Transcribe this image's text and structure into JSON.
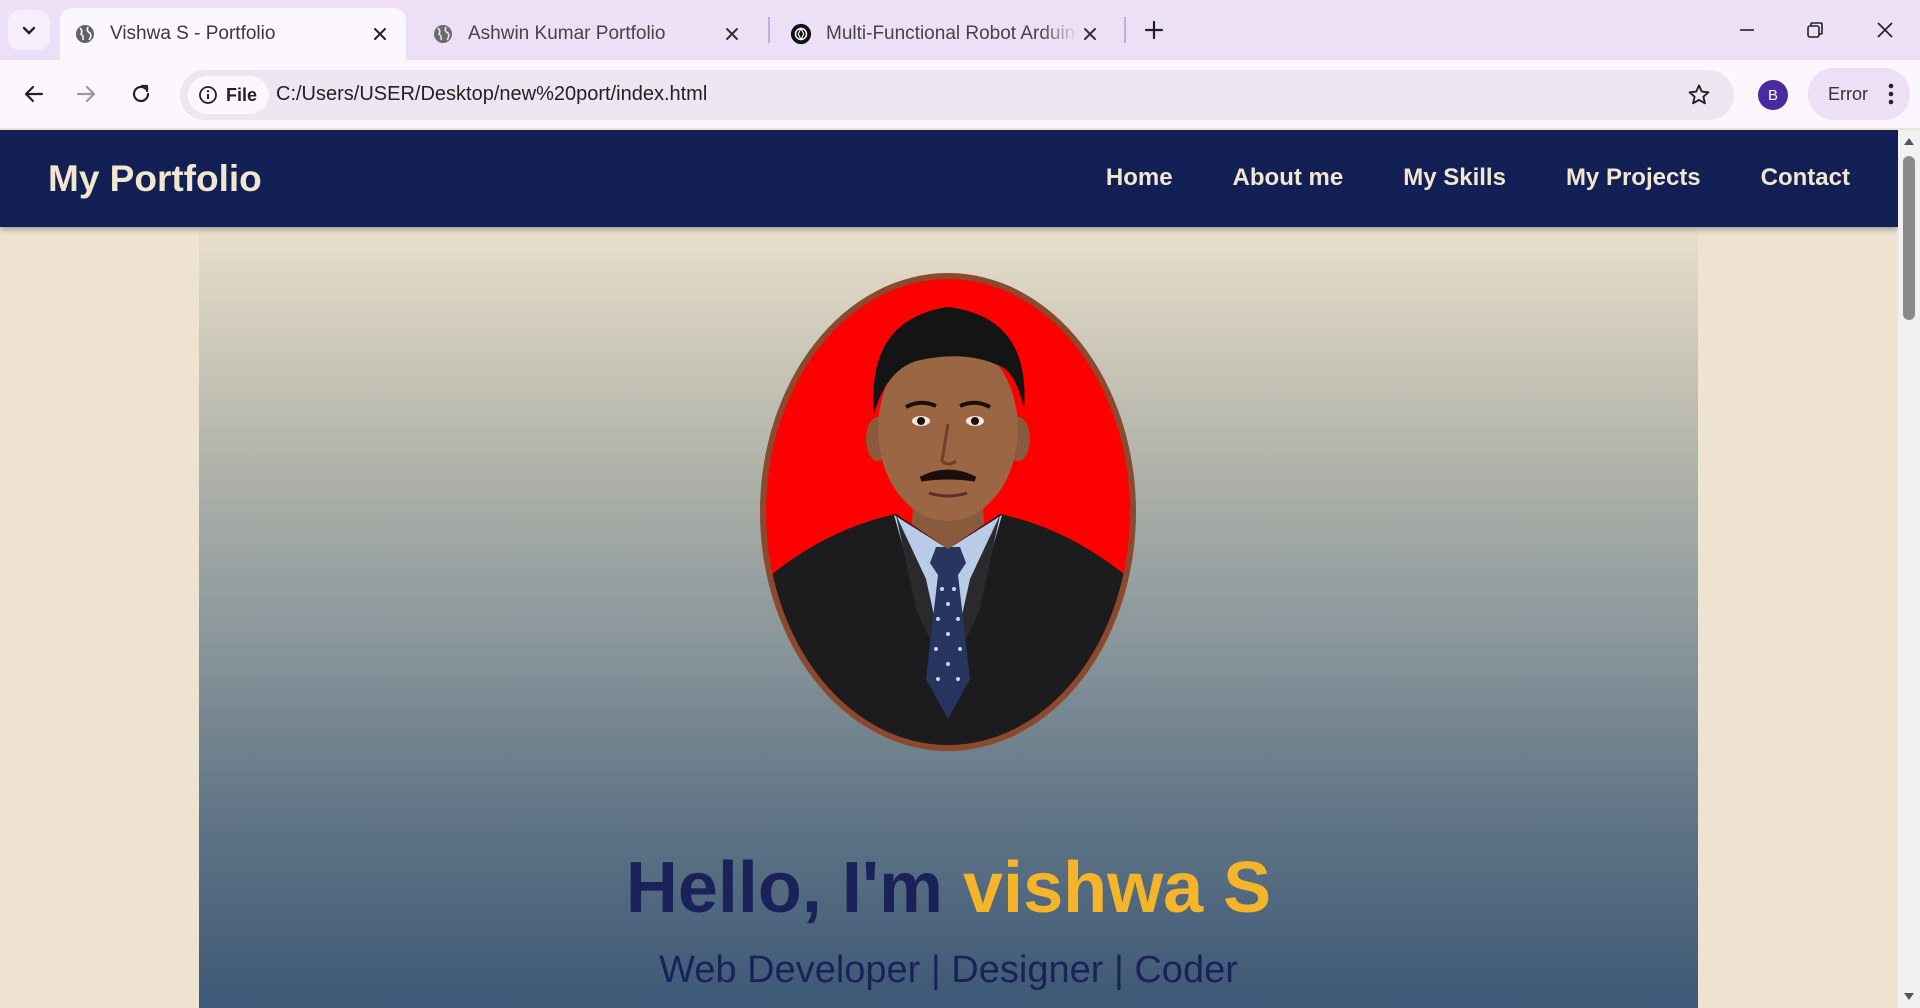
{
  "browser": {
    "tabs": [
      {
        "label": "Vishwa S - Portfolio",
        "active": true,
        "icon": "globe-icon"
      },
      {
        "label": "Ashwin Kumar Portfolio",
        "active": false,
        "icon": "globe-icon"
      },
      {
        "label": "Multi-Functional Robot Arduino",
        "active": false,
        "icon": "chatgpt-icon"
      }
    ],
    "address": {
      "chip_label": "File",
      "url": "C:/Users/USER/Desktop/new%20port/index.html"
    },
    "profile_initial": "B",
    "error_label": "Error"
  },
  "site": {
    "logo": "My Portfolio",
    "nav": [
      "Home",
      "About me",
      "My Skills",
      "My Projects",
      "Contact"
    ],
    "hero": {
      "greeting": "Hello, I'm ",
      "name": "vishwa S",
      "tagline": "Web Developer | Designer | Coder"
    }
  },
  "colors": {
    "nav_bg": "#132055",
    "nav_text": "#f2e6cf",
    "accent_name": "#f5b52a",
    "heading_text": "#1a2259",
    "photo_bg": "#ff0000",
    "photo_border": "#8b4a2e"
  }
}
